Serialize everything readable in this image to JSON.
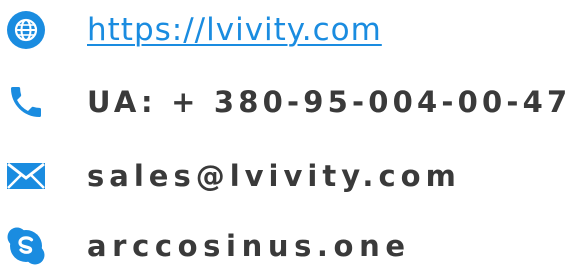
{
  "colors": {
    "accent": "#1a8ce0",
    "text": "#3a3a3a"
  },
  "contacts": [
    {
      "icon": "globe-icon",
      "text": "https://lvivity.com"
    },
    {
      "icon": "phone-icon",
      "text": "UA: + 380-95-004-00-47"
    },
    {
      "icon": "mail-icon",
      "text": "sales@lvivity.com"
    },
    {
      "icon": "skype-icon",
      "text": "arccosinus.one"
    }
  ]
}
